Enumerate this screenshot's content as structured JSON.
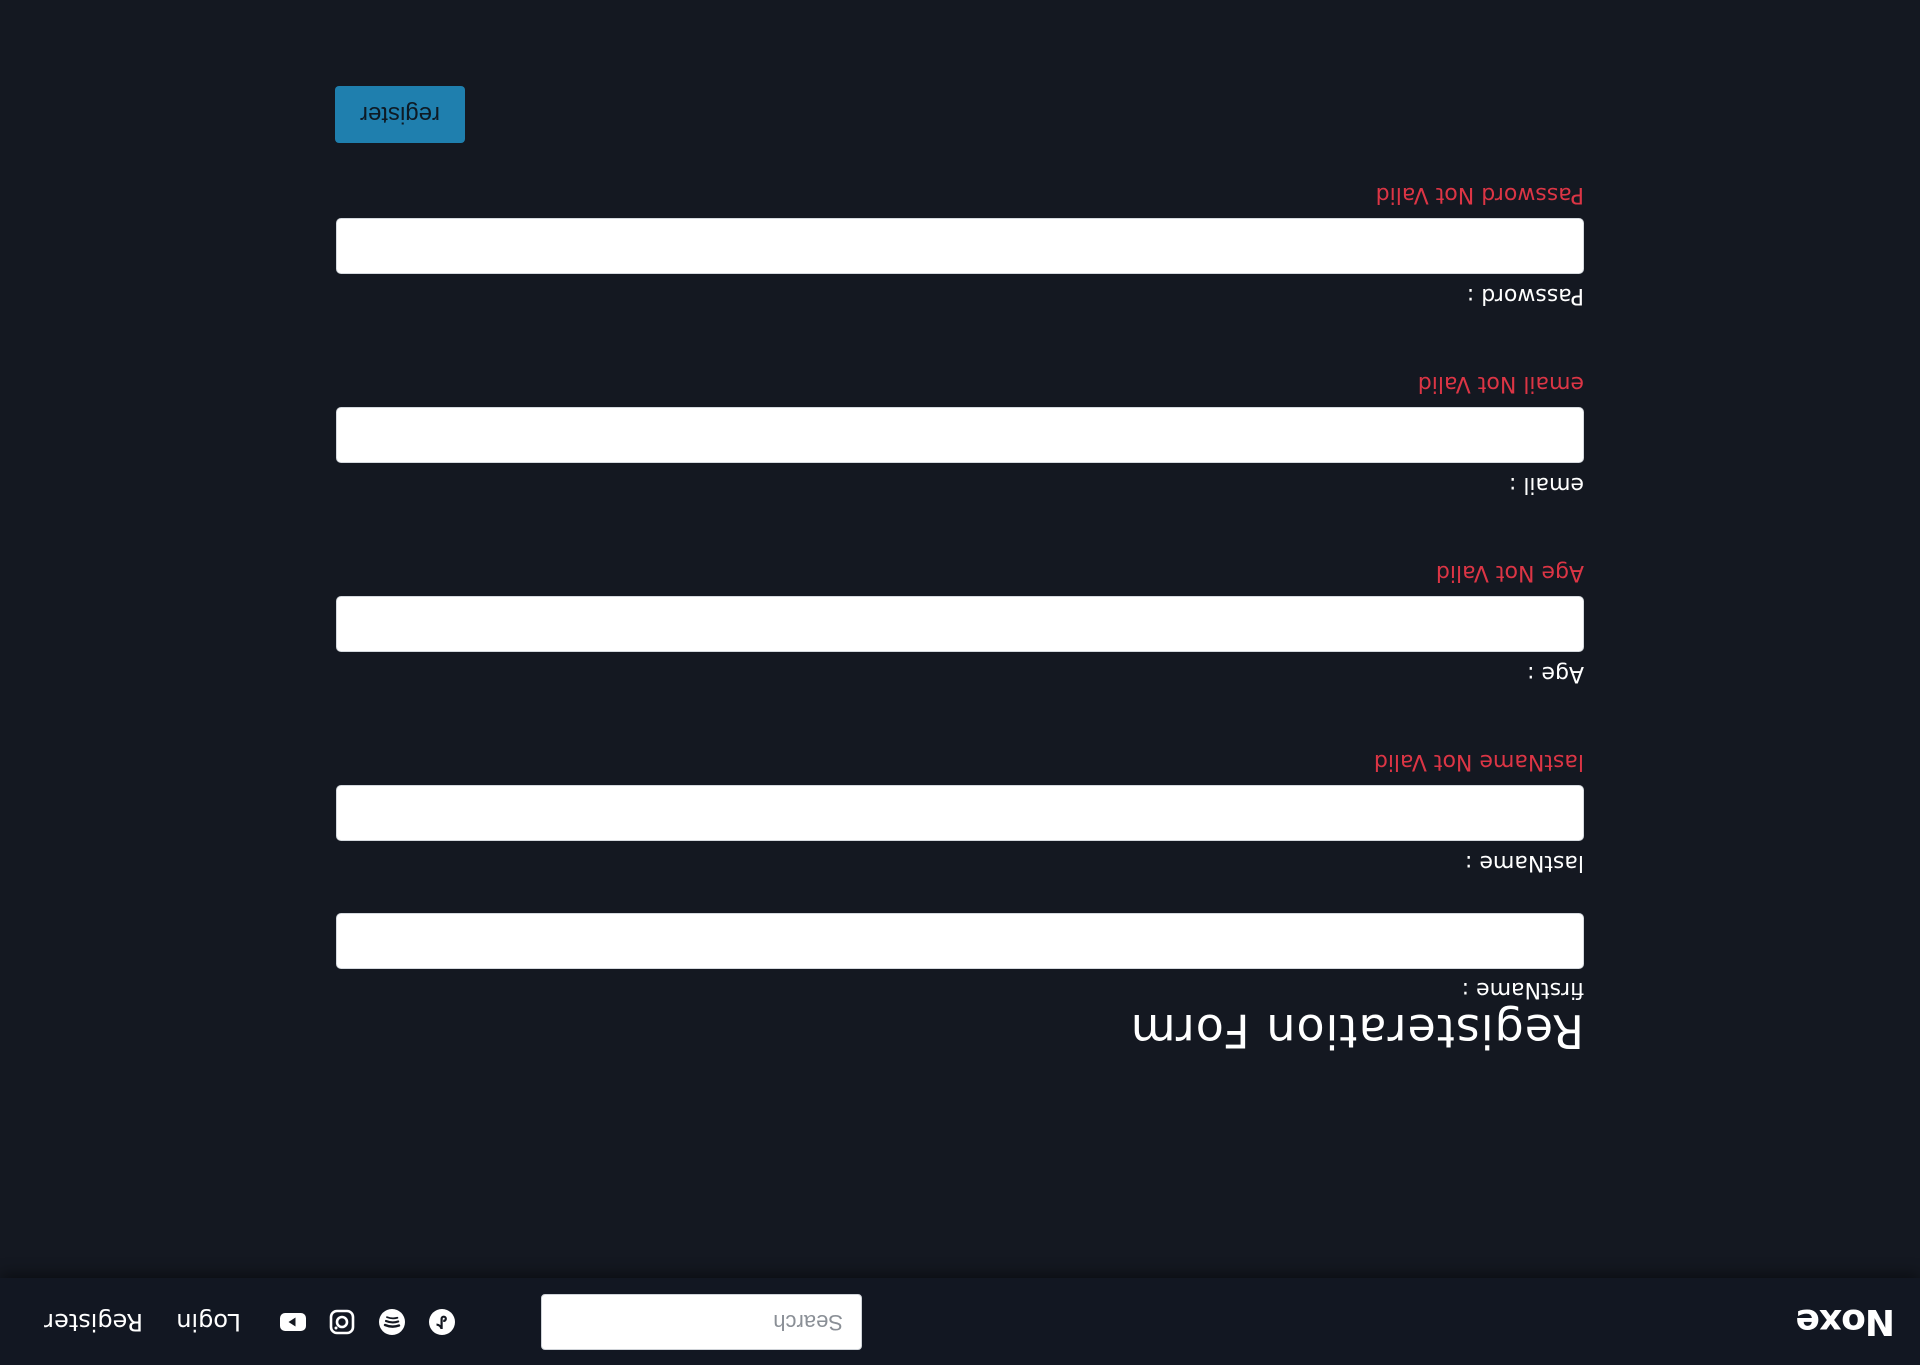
{
  "navbar": {
    "brand": "Noxe",
    "search_placeholder": "Search",
    "social_icons": [
      "tiktok-icon",
      "spotify-icon",
      "instagram-icon",
      "youtube-icon"
    ],
    "links": {
      "login": "Login",
      "register": "Register"
    }
  },
  "form": {
    "title": "Registeration Form",
    "fields": {
      "first_name": {
        "label": "firstName :",
        "value": ""
      },
      "last_name": {
        "label": "lastName :",
        "value": "",
        "error": "lastName Not Valid"
      },
      "age": {
        "label": "Age :",
        "value": "",
        "error": "Age Not Valid"
      },
      "email": {
        "label": "email :",
        "value": "",
        "error": "email Not Valid"
      },
      "password": {
        "label": "Password :",
        "value": "",
        "error": "Password Not Valid"
      }
    },
    "submit_label": "register"
  },
  "colors": {
    "background": "#141821",
    "error": "#dc3545",
    "button": "#1f7fae"
  }
}
